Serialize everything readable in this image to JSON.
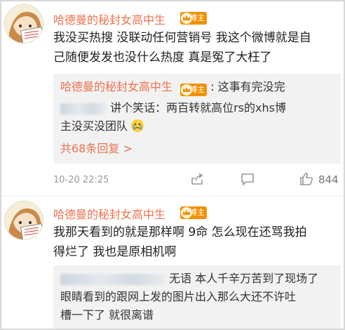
{
  "comments": [
    {
      "username": "哈德曼的秘封女高中生",
      "badge": "博主",
      "text_line1": "我没买热搜 没联动任何营销号 我这个微博就是自",
      "text_line2": "己随便发发也没什么热度 真是冤了大枉了",
      "replies": [
        {
          "name": "哈德曼的秘封女高中生",
          "badge": "博主",
          "text": ": 这事有完没完"
        },
        {
          "text_line1": " 讲个笑话：两百转就高位rs的xhs博",
          "text_line2": "主没买没团队"
        }
      ],
      "more_replies": "共68条回复 >",
      "timestamp": "10-20 22:25",
      "like_count": "844"
    },
    {
      "username": "哈德曼的秘封女高中生",
      "badge": "博主",
      "text_line1": "我那天看到的就是那样啊 9命 怎么现在还骂我拍",
      "text_line2": "得烂了 我也是原相机啊",
      "replies": [
        {
          "text_line1": "无语  本人千辛万苦到了现场了",
          "text_line2": "眼睛看到的跟网上发的图片出入那么大还不许吐",
          "text_line3": "槽一下了   就很离谱"
        }
      ]
    }
  ],
  "icons": {
    "share": "share-icon",
    "comment": "comment-icon",
    "like": "like-icon",
    "emoji": "crying-face-emoji",
    "avatar": "cartoon-avatar"
  },
  "colors": {
    "username": "#eb7350",
    "badge": "#f29100",
    "reply_bg": "#f2f2f2",
    "meta": "#999999"
  }
}
